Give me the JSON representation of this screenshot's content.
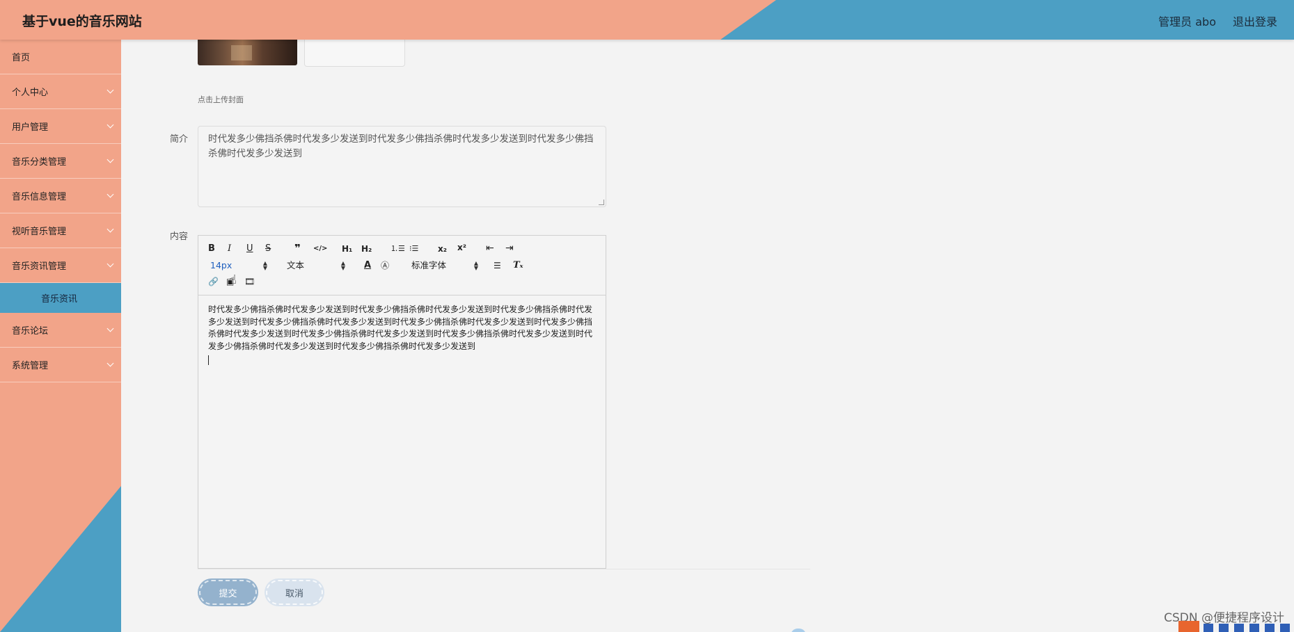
{
  "header": {
    "title": "基于vue的音乐网站",
    "user": "管理员 abo",
    "logout": "退出登录"
  },
  "sidebar": {
    "items": [
      {
        "label": "首页"
      },
      {
        "label": "个人中心"
      },
      {
        "label": "用户管理"
      },
      {
        "label": "音乐分类管理"
      },
      {
        "label": "音乐信息管理"
      },
      {
        "label": "视听音乐管理"
      },
      {
        "label": "音乐资讯管理"
      },
      {
        "label": "音乐资讯"
      },
      {
        "label": "音乐论坛"
      },
      {
        "label": "系统管理"
      }
    ]
  },
  "form": {
    "upload_hint": "点击上传封面",
    "summary_label": "简介",
    "summary_value": "时代发多少佛挡杀佛时代发多少发送到时代发多少佛挡杀佛时代发多少发送到时代发多少佛挡杀佛时代发多少发送到",
    "content_label": "内容",
    "content_value": "时代发多少佛挡杀佛时代发多少发送到时代发多少佛挡杀佛时代发多少发送到时代发多少佛挡杀佛时代发多少发送到时代发多少佛挡杀佛时代发多少发送到时代发多少佛挡杀佛时代发多少发送到时代发多少佛挡杀佛时代发多少发送到时代发多少佛挡杀佛时代发多少发送到时代发多少佛挡杀佛时代发多少发送到时代发多少佛挡杀佛时代发多少发送到时代发多少佛挡杀佛时代发多少发送到",
    "submit": "提交",
    "cancel": "取消"
  },
  "toolbar": {
    "bold": "B",
    "italic": "I",
    "underline": "U",
    "strike": "S",
    "blockquote": "❞",
    "code": "</>",
    "h1": "H₁",
    "h2": "H₂",
    "ordered_list": "⒈☰",
    "bullet_list": "⁝☰",
    "subscript": "x₂",
    "superscript": "x²",
    "outdent": "⇤",
    "indent": "⇥",
    "size_value": "14px",
    "header_value": "文本",
    "font_value": "标准字体",
    "color": "A",
    "background": "Ⓐ",
    "align": "☰",
    "clean": "Tₓ",
    "link": "🔗",
    "image": "▣",
    "video": "🎞"
  },
  "watermark": "CSDN @便捷程序设计"
}
